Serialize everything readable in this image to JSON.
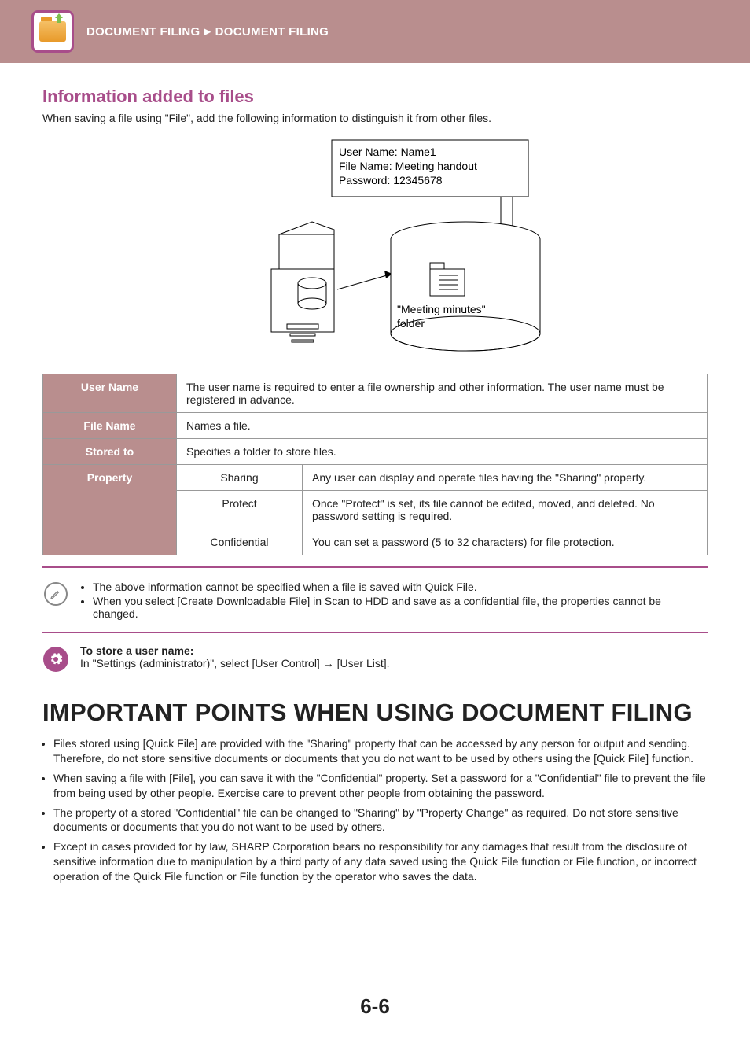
{
  "header": {
    "breadcrumb_a": "DOCUMENT FILING",
    "breadcrumb_sep": "►",
    "breadcrumb_b": "DOCUMENT FILING"
  },
  "section_title": "Information added to files",
  "intro": "When saving a file using \"File\", add the following information to distinguish it from other files.",
  "diagram": {
    "line1": "User Name: Name1",
    "line2": "File Name: Meeting handout",
    "line3": "Password: 12345678",
    "folder_label_a": "\"Meeting minutes\"",
    "folder_label_b": "folder"
  },
  "table": {
    "user_name": {
      "label": "User Name",
      "desc": "The user name is required to enter a file ownership and other information. The user name must be registered in advance."
    },
    "file_name": {
      "label": "File Name",
      "desc": "Names a file."
    },
    "stored_to": {
      "label": "Stored to",
      "desc": "Specifies a folder to store files."
    },
    "property": {
      "label": "Property",
      "rows": [
        {
          "sub": "Sharing",
          "desc": "Any user can display and operate files having the \"Sharing\" property."
        },
        {
          "sub": "Protect",
          "desc": "Once \"Protect\" is set, its file cannot be edited, moved, and deleted. No password setting is required."
        },
        {
          "sub": "Confidential",
          "desc": "You can set a password (5 to 32 characters) for file protection."
        }
      ]
    }
  },
  "note1": {
    "b1": "The above information cannot be specified when a file is saved with Quick File.",
    "b2": "When you select [Create Downloadable File] in Scan to HDD and save as a confidential file, the properties cannot be changed."
  },
  "note2": {
    "title": "To store a user name:",
    "body": "In \"Settings (administrator)\", select [User Control] → [User List]."
  },
  "big_heading": "IMPORTANT POINTS WHEN USING DOCUMENT FILING",
  "points": [
    "Files stored using [Quick File] are provided with the \"Sharing\" property that can be accessed by any person for output and sending. Therefore, do not store sensitive documents or documents that you do not want to be used by others using the [Quick File] function.",
    "When saving a file with [File], you can save it with the \"Confidential\" property. Set a password for a \"Confidential\" file to prevent the file from being used by other people. Exercise care to prevent other people from obtaining the password.",
    "The property of a stored \"Confidential\" file can be changed to \"Sharing\" by \"Property Change\" as required. Do not store sensitive documents or documents that you do not want to be used by others.",
    "Except in cases provided for by law, SHARP Corporation bears no responsibility for any damages that result from the disclosure of sensitive information due to manipulation by a third party of any data saved using the Quick File function or File function, or incorrect operation of the Quick File function or File function by the operator who saves the data."
  ],
  "page_number": "6-6"
}
